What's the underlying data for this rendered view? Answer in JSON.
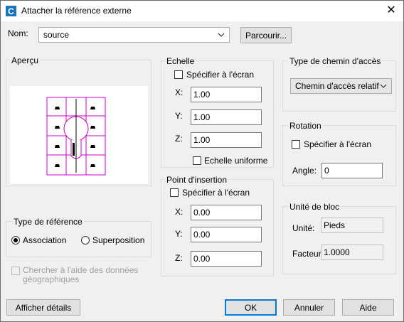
{
  "window": {
    "title": "Attacher la référence externe",
    "close_glyph": "✕"
  },
  "name": {
    "label": "Nom:",
    "value": "source",
    "browse_label": "Parcourir..."
  },
  "preview": {
    "label": "Aperçu"
  },
  "scale": {
    "label": "Echelle",
    "specify_label": "Spécifier à l'écran",
    "x_label": "X:",
    "x_value": "1.00",
    "y_label": "Y:",
    "y_value": "1.00",
    "z_label": "Z:",
    "z_value": "1.00",
    "uniform_label": "Echelle uniforme"
  },
  "path_type": {
    "label": "Type de chemin d'accès",
    "value": "Chemin d'accès relatif"
  },
  "rotation": {
    "label": "Rotation",
    "specify_label": "Spécifier à l'écran",
    "angle_label": "Angle:",
    "angle_value": "0"
  },
  "insertion": {
    "label": "Point d'insertion",
    "specify_label": "Spécifier à l'écran",
    "x_label": "X:",
    "x_value": "0.00",
    "y_label": "Y:",
    "y_value": "0.00",
    "z_label": "Z:",
    "z_value": "0.00"
  },
  "block_unit": {
    "label": "Unité de bloc",
    "unit_label": "Unité:",
    "unit_value": "Pieds",
    "factor_label": "Facteur:",
    "factor_value": "1.0000"
  },
  "ref_type": {
    "label": "Type de référence",
    "attach_label": "Association",
    "overlay_label": "Superposition",
    "selected": "Association"
  },
  "geo": {
    "label_line1": "Chercher à l'aide des données",
    "label_line2": "géographiques"
  },
  "footer": {
    "details_label": "Afficher détails",
    "ok_label": "OK",
    "cancel_label": "Annuler",
    "help_label": "Aide"
  },
  "icons": {
    "app": "autocad-c-icon",
    "chevron": "chevron-down-icon",
    "close": "close-icon"
  },
  "colors": {
    "accent": "#0078d7",
    "preview_lines": "#cc00cc"
  }
}
